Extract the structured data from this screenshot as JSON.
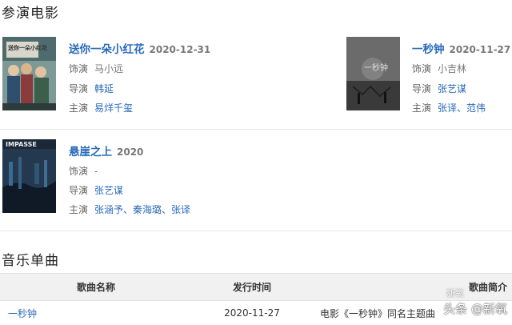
{
  "films_section": {
    "title": "参演电影"
  },
  "films": [
    {
      "title": "送你一朵小红花",
      "date": "2020-12-31",
      "poster_text": "送你一朵小红花",
      "rows": [
        {
          "key": "饰演",
          "value": "马小远"
        },
        {
          "key": "导演",
          "value": "韩延"
        },
        {
          "key": "主演",
          "value": "易烊千玺"
        }
      ]
    },
    {
      "title": "一秒钟",
      "date": "2020-11-27",
      "poster_text": "一秒钟",
      "rows": [
        {
          "key": "饰演",
          "value": "小吉林"
        },
        {
          "key": "导演",
          "value": "张艺谋"
        },
        {
          "key": "主演",
          "value": "张译、范伟"
        }
      ]
    },
    {
      "title": "悬崖之上",
      "date": "2020",
      "poster_text": "IMPASSE",
      "rows": [
        {
          "key": "饰演",
          "value": "-"
        },
        {
          "key": "导演",
          "value": "张艺谋"
        },
        {
          "key": "主演",
          "value": "张涵予、秦海璐、张译"
        }
      ]
    }
  ],
  "music_section": {
    "title": "音乐单曲"
  },
  "songs_table": {
    "headers": [
      "歌曲名称",
      "发行时间",
      "歌曲简介"
    ],
    "rows": [
      {
        "name": "一秒钟",
        "date": "2020-11-27",
        "intro": "电影《一秒钟》同名主题曲"
      }
    ]
  },
  "watermark": {
    "text": "头条 @新氧",
    "logo_text": "新氧"
  },
  "colors": {
    "link": "#2a6ab8",
    "header_bg": "#f1f1f1"
  }
}
